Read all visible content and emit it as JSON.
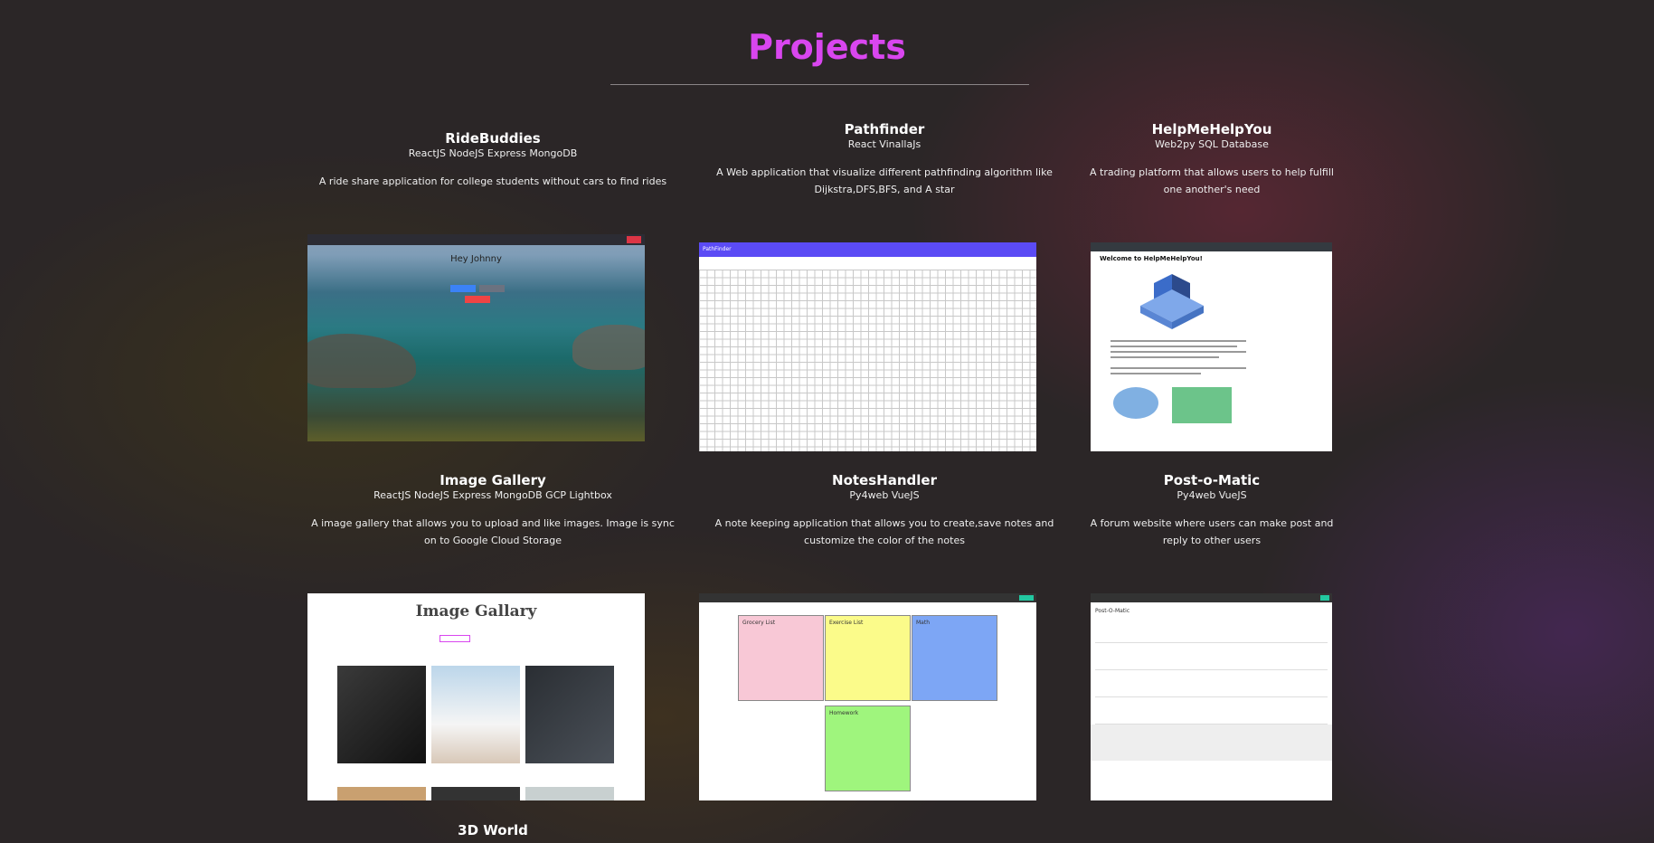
{
  "title": "Projects",
  "projects": [
    {
      "name": "RideBuddies",
      "tech": "ReactJS NodeJS Express MongoDB",
      "desc": "A ride share application for college students without cars to find rides"
    },
    {
      "name": "Pathfinder",
      "tech": "React VinallaJs",
      "desc": "A Web application that visualize different pathfinding algorithm like Dijkstra,DFS,BFS, and A star"
    },
    {
      "name": "HelpMeHelpYou",
      "tech": "Web2py SQL Database",
      "desc": "A trading platform that allows users to help fulfill one another's need"
    },
    {
      "name": "Image Gallery",
      "tech": "ReactJS NodeJS Express MongoDB GCP Lightbox",
      "desc": "A image gallery that allows you to upload and like images. Image is sync on to Google Cloud Storage"
    },
    {
      "name": "NotesHandler",
      "tech": "Py4web VueJS",
      "desc": "A note keeping application that allows you to create,save notes and customize the color of the notes"
    },
    {
      "name": "Post-o-Matic",
      "tech": "Py4web VueJS",
      "desc": "A forum website where users can make post and reply to other users"
    },
    {
      "name": "3D World",
      "tech": "",
      "desc": ""
    }
  ],
  "screens": {
    "ridebuddies": {
      "greeting": "Hey Johnny"
    },
    "pathfinder": {
      "brand": "PathFinder"
    },
    "helpme": {
      "heading": "Welcome to HelpMeHelpYou!"
    },
    "gallery": {
      "heading": "Image Gallary"
    },
    "notes": {
      "titles": [
        "Grocery List",
        "Exercise List",
        "Math",
        "Homework"
      ],
      "colors": [
        "#f8c8d6",
        "#fbfb8a",
        "#7da6f5",
        "#9ff57d"
      ]
    },
    "postomatic": {
      "heading": "Post-O-Matic"
    }
  }
}
